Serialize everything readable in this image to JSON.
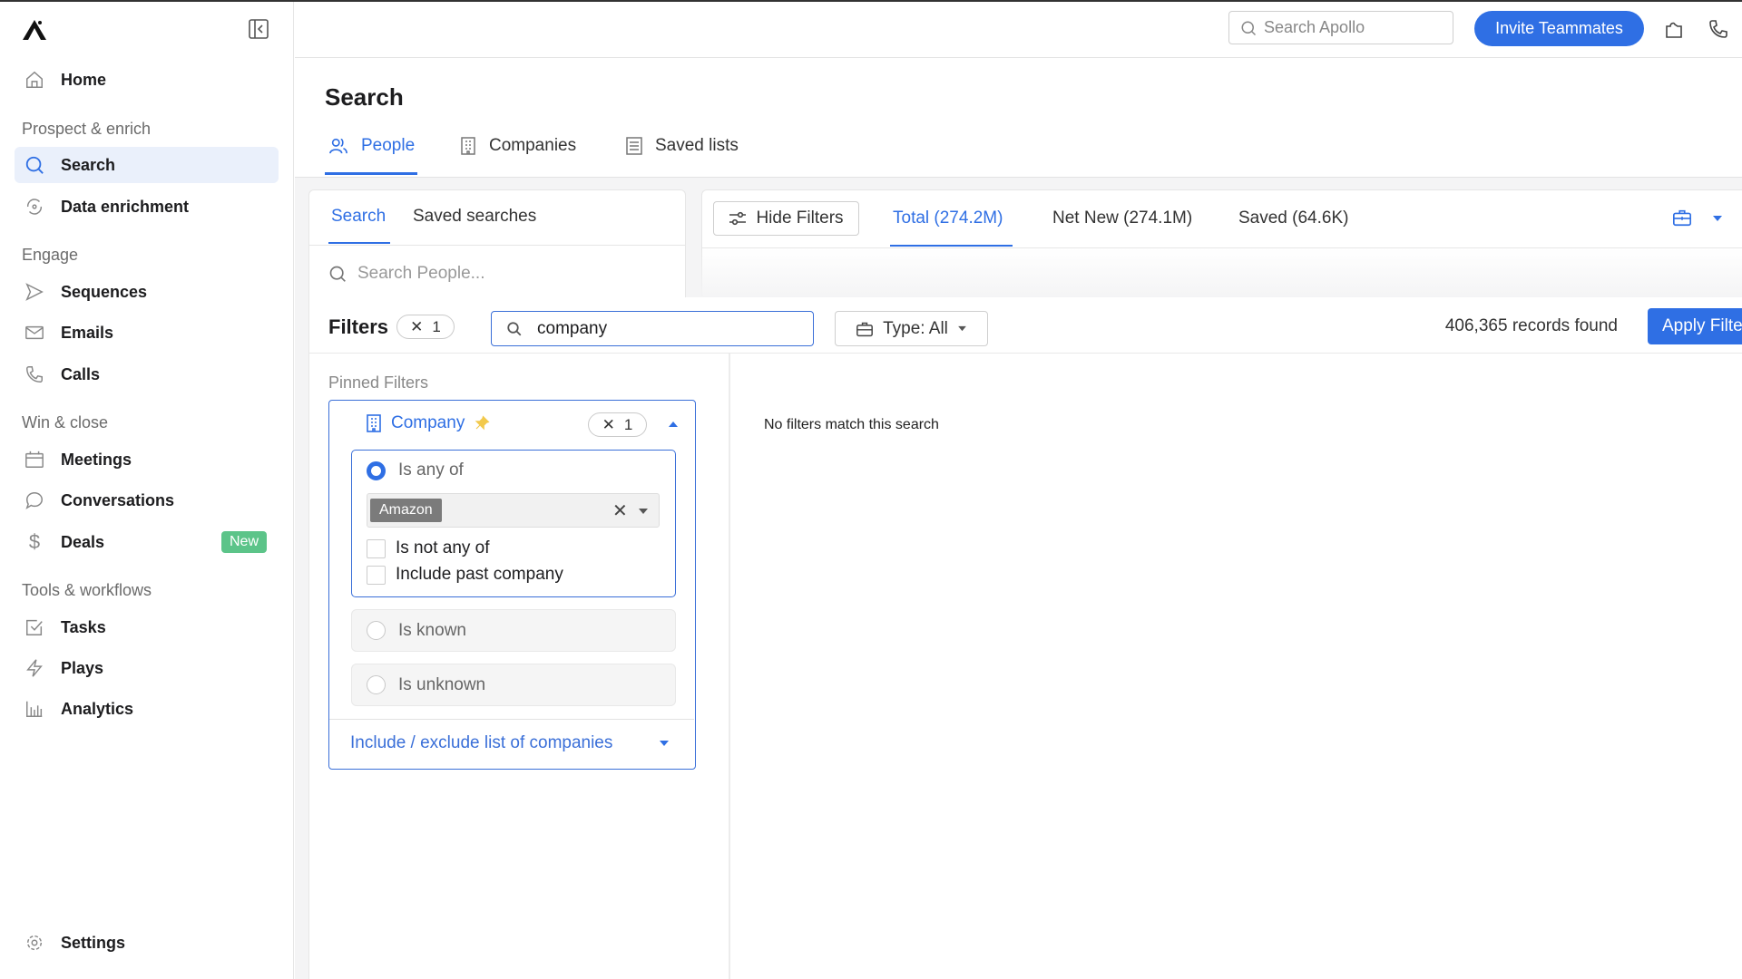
{
  "sidebar": {
    "items": [
      {
        "label": "Home",
        "icon": "home-icon"
      },
      {
        "label": "Search",
        "icon": "search-icon",
        "active": true
      },
      {
        "label": "Data enrichment",
        "icon": "refresh-icon"
      },
      {
        "label": "Sequences",
        "icon": "send-icon"
      },
      {
        "label": "Emails",
        "icon": "mail-icon"
      },
      {
        "label": "Calls",
        "icon": "phone-icon"
      },
      {
        "label": "Meetings",
        "icon": "calendar-icon"
      },
      {
        "label": "Conversations",
        "icon": "chat-icon"
      },
      {
        "label": "Deals",
        "icon": "dollar-icon",
        "badge": "New"
      },
      {
        "label": "Tasks",
        "icon": "checkbox-icon"
      },
      {
        "label": "Plays",
        "icon": "bolt-icon"
      },
      {
        "label": "Analytics",
        "icon": "bar-chart-icon"
      },
      {
        "label": "Settings",
        "icon": "gear-icon"
      }
    ],
    "sections": [
      "Prospect & enrich",
      "Engage",
      "Win & close",
      "Tools & workflows"
    ]
  },
  "topbar": {
    "search_placeholder": "Search Apollo",
    "invite_label": "Invite Teammates"
  },
  "page": {
    "title": "Search",
    "tabs": [
      {
        "label": "People",
        "active": true
      },
      {
        "label": "Companies"
      },
      {
        "label": "Saved lists"
      }
    ]
  },
  "left_card": {
    "tabs": [
      "Search",
      "Saved searches"
    ],
    "search_placeholder": "Search People..."
  },
  "results_bar": {
    "hide_filters": "Hide Filters",
    "tabs": [
      {
        "label": "Total (274.2M)",
        "active": true
      },
      {
        "label": "Net New (274.1M)"
      },
      {
        "label": "Saved (64.6K)"
      }
    ]
  },
  "filters": {
    "title": "Filters",
    "count": "1",
    "search_value": "company",
    "type_label": "Type: All",
    "records_found": "406,365 records found",
    "apply_label": "Apply Filters",
    "pinned_label": "Pinned Filters",
    "no_match": "No filters match this search",
    "company": {
      "label": "Company",
      "count": "1",
      "is_any_of": "Is any of",
      "selected_tag": "Amazon",
      "is_not_any_of": "Is not any of",
      "include_past": "Include past company",
      "is_known": "Is known",
      "is_unknown": "Is unknown",
      "include_exclude": "Include / exclude list of companies"
    }
  },
  "colors": {
    "accent": "#2f6fe4",
    "badge_new": "#5cc489",
    "pin": "#f2c94c"
  }
}
